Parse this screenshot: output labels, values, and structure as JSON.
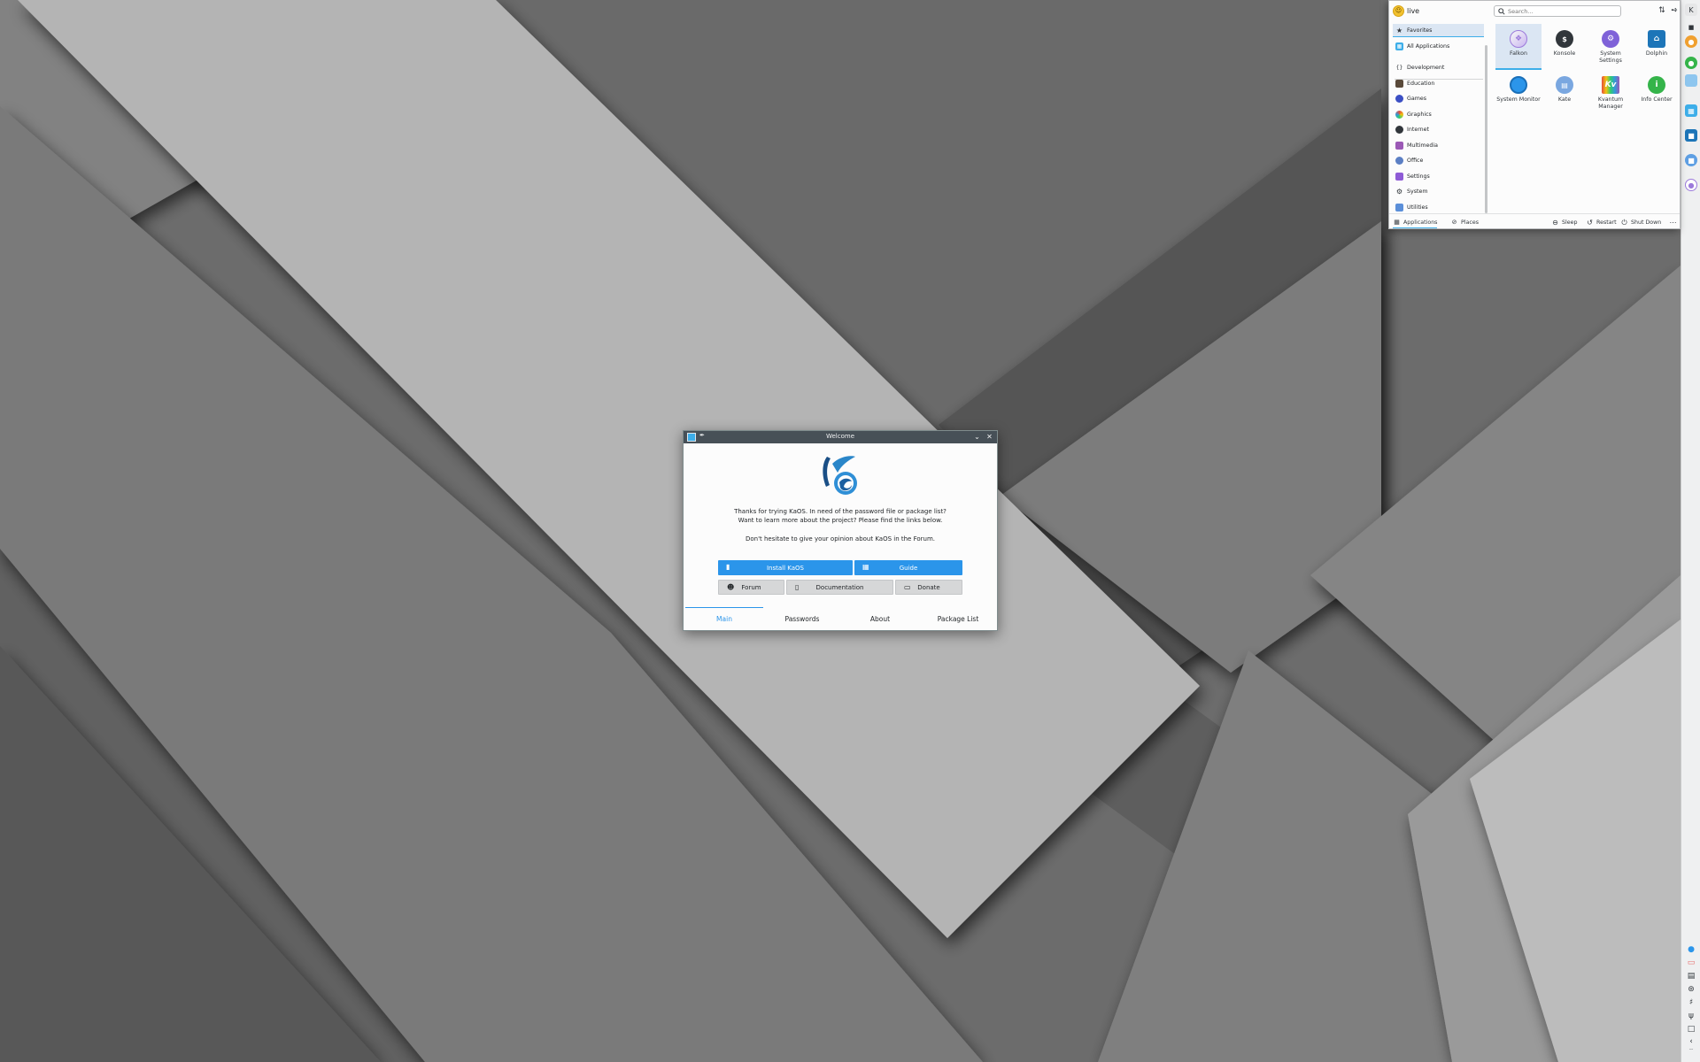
{
  "colors": {
    "accent": "#3daee9",
    "button_blue": "#2b95ea",
    "titlebar": "#475057",
    "wallpaper_light": "#b5b5b5",
    "wallpaper_dark": "#4a4a4a"
  },
  "launcher": {
    "user_name": "live",
    "search_placeholder": "Search...",
    "categories": [
      {
        "label": "Favorites",
        "icon": "star-icon",
        "selected": true
      },
      {
        "label": "All Applications",
        "icon": "grid-icon"
      },
      {
        "label": "Development",
        "icon": "code-icon"
      },
      {
        "label": "Education",
        "icon": "blackboard-icon"
      },
      {
        "label": "Games",
        "icon": "gamepad-icon"
      },
      {
        "label": "Graphics",
        "icon": "palette-icon"
      },
      {
        "label": "Internet",
        "icon": "globe-icon"
      },
      {
        "label": "Multimedia",
        "icon": "media-icon"
      },
      {
        "label": "Office",
        "icon": "office-icon"
      },
      {
        "label": "Settings",
        "icon": "settings-icon"
      },
      {
        "label": "System",
        "icon": "gear-icon"
      },
      {
        "label": "Utilities",
        "icon": "utilities-icon"
      }
    ],
    "apps": [
      {
        "label": "Falkon",
        "icon": "falkon-icon",
        "selected": true
      },
      {
        "label": "Konsole",
        "icon": "terminal-icon"
      },
      {
        "label": "System Settings",
        "icon": "system-settings-icon"
      },
      {
        "label": "Dolphin",
        "icon": "folder-icon"
      },
      {
        "label": "System Monitor",
        "icon": "system-monitor-icon"
      },
      {
        "label": "Kate",
        "icon": "text-editor-icon"
      },
      {
        "label": "Kvantum Manager",
        "icon": "kvantum-icon"
      },
      {
        "label": "Info Center",
        "icon": "info-icon"
      }
    ],
    "footer": {
      "applications": "Applications",
      "places": "Places",
      "sleep": "Sleep",
      "restart": "Restart",
      "shutdown": "Shut Down"
    }
  },
  "welcome": {
    "title": "Welcome",
    "intro_line1": "Thanks for trying KaOS. In need of the password file or package list?",
    "intro_line2": "Want to learn more about the project? Please find the links below.",
    "intro_line3": "Don't hesitate to give your opinion about KaOS in the Forum.",
    "buttons": {
      "install": "Install KaOS",
      "guide": "Guide",
      "forum": "Forum",
      "documentation": "Documentation",
      "donate": "Donate"
    },
    "tabs": [
      "Main",
      "Passwords",
      "About",
      "Package List"
    ],
    "active_tab": "Main"
  }
}
